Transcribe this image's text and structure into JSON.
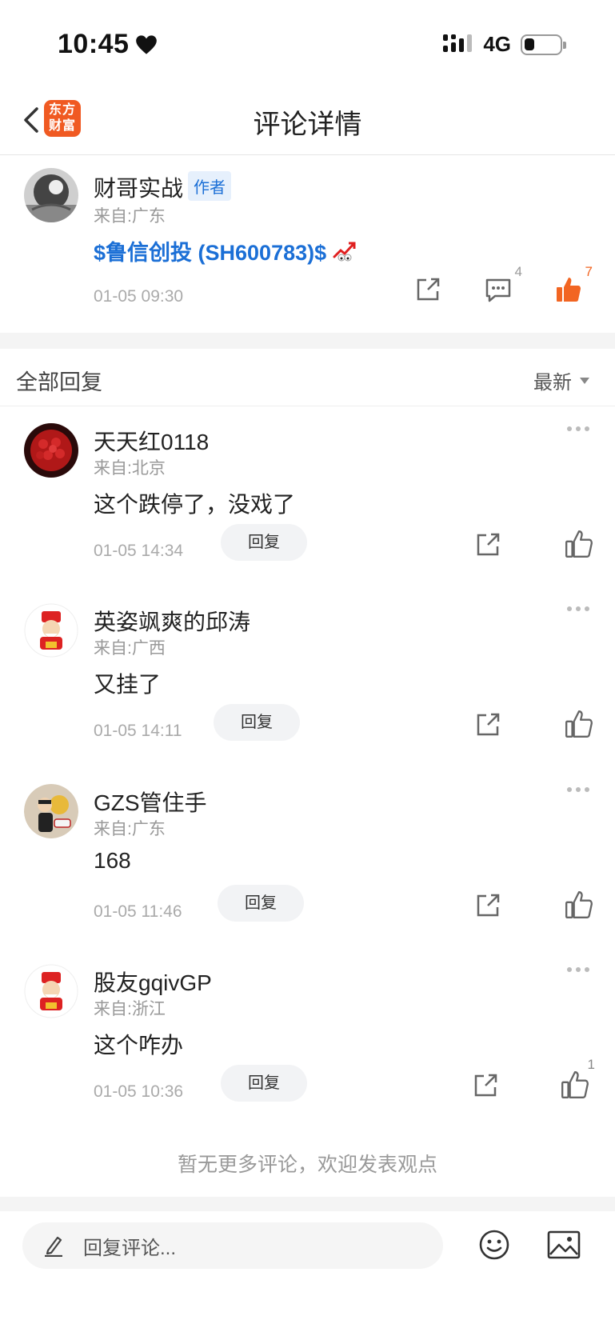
{
  "status_bar": {
    "time": "10:45",
    "network": "4G"
  },
  "nav": {
    "title": "评论详情",
    "brand_line1": "东方",
    "brand_line2": "财富"
  },
  "post": {
    "user": "财哥实战",
    "author_tag": "作者",
    "location": "来自:广东",
    "stock_text": "$鲁信创投 (SH600783)$",
    "time": "01-05 09:30",
    "comment_count": "4",
    "like_count": "7"
  },
  "replies_header": {
    "title": "全部回复",
    "sort": "最新"
  },
  "replies": [
    {
      "user": "天天红0118",
      "location": "来自:北京",
      "text": "这个跌停了，没戏了",
      "time": "01-05 14:34",
      "reply_label": "回复",
      "likes": ""
    },
    {
      "user": "英姿飒爽的邱涛",
      "location": "来自:广西",
      "text": "又挂了",
      "time": "01-05 14:11",
      "reply_label": "回复",
      "likes": ""
    },
    {
      "user": "GZS管住手",
      "location": "来自:广东",
      "text": "168",
      "time": "01-05 11:46",
      "reply_label": "回复",
      "likes": ""
    },
    {
      "user": "股友gqivGP",
      "location": "来自:浙江",
      "text": "这个咋办",
      "time": "01-05 10:36",
      "reply_label": "回复",
      "likes": "1"
    }
  ],
  "no_more": "暂无更多评论，欢迎发表观点",
  "input": {
    "placeholder": "回复评论..."
  },
  "colors": {
    "accent_orange": "#f26522",
    "link_blue": "#1b6fd6",
    "brand_orange": "#f05a22"
  }
}
